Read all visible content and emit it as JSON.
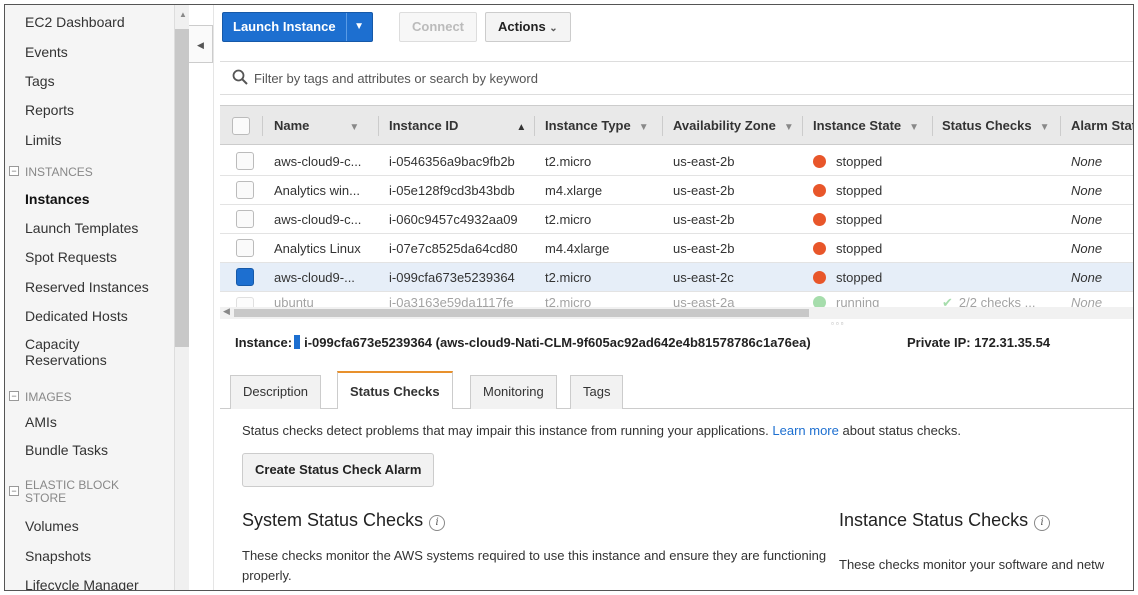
{
  "sidebar": {
    "items": [
      {
        "label": "EC2 Dashboard"
      },
      {
        "label": "Events"
      },
      {
        "label": "Tags"
      },
      {
        "label": "Reports"
      },
      {
        "label": "Limits"
      }
    ],
    "sections": [
      {
        "title": "INSTANCES",
        "items": [
          "Instances",
          "Launch Templates",
          "Spot Requests",
          "Reserved Instances",
          "Dedicated Hosts",
          "Capacity Reservations"
        ]
      },
      {
        "title": "IMAGES",
        "items": [
          "AMIs",
          "Bundle Tasks"
        ]
      },
      {
        "title": "ELASTIC BLOCK STORE",
        "items": [
          "Volumes",
          "Snapshots",
          "Lifecycle Manager"
        ]
      }
    ],
    "active": "Instances"
  },
  "toolbar": {
    "launch_label": "Launch Instance",
    "connect_label": "Connect",
    "actions_label": "Actions"
  },
  "search": {
    "placeholder": "Filter by tags and attributes or search by keyword"
  },
  "table": {
    "columns": [
      "Name",
      "Instance ID",
      "Instance Type",
      "Availability Zone",
      "Instance State",
      "Status Checks",
      "Alarm Stat"
    ],
    "rows": [
      {
        "name": "aws-cloud9-c...",
        "id": "i-0546356a9bac9fb2b",
        "type": "t2.micro",
        "az": "us-east-2b",
        "state": "stopped",
        "checks": "",
        "alarm": "None"
      },
      {
        "name": "Analytics win...",
        "id": "i-05e128f9cd3b43bdb",
        "type": "m4.xlarge",
        "az": "us-east-2b",
        "state": "stopped",
        "checks": "",
        "alarm": "None"
      },
      {
        "name": "aws-cloud9-c...",
        "id": "i-060c9457c4932aa09",
        "type": "t2.micro",
        "az": "us-east-2b",
        "state": "stopped",
        "checks": "",
        "alarm": "None"
      },
      {
        "name": "Analytics Linux",
        "id": "i-07e7c8525da64cd80",
        "type": "m4.4xlarge",
        "az": "us-east-2b",
        "state": "stopped",
        "checks": "",
        "alarm": "None"
      },
      {
        "name": "aws-cloud9-...",
        "id": "i-099cfa673e5239364",
        "type": "t2.micro",
        "az": "us-east-2c",
        "state": "stopped",
        "checks": "",
        "alarm": "None"
      },
      {
        "name": "ubuntu",
        "id": "i-0a3163e59da1117fe",
        "type": "t2.micro",
        "az": "us-east-2a",
        "state": "running",
        "checks": "2/2 checks ...",
        "alarm": "None"
      }
    ],
    "selected_index": 4
  },
  "colors": {
    "stopped": "#e8562a",
    "running": "#3bb44a",
    "accent": "#1d6fd0",
    "tab_accent": "#e8912d"
  },
  "details": {
    "instance_label": "Instance:",
    "instance_value": "i-099cfa673e5239364 (aws-cloud9-Nati-CLM-9f605ac92ad642e4b81578786c1a76ea)",
    "private_ip": "Private IP: 172.31.35.54",
    "tabs": [
      "Description",
      "Status Checks",
      "Monitoring",
      "Tags"
    ],
    "active_tab": "Status Checks",
    "intro_text": "Status checks detect problems that may impair this instance from running your applications.",
    "learn_more": "Learn more",
    "intro_suffix": "about status checks.",
    "alarm_button": "Create Status Check Alarm",
    "system_title": "System Status Checks",
    "system_text": "These checks monitor the AWS systems required to use this instance and ensure they are functioning properly.",
    "instance_title": "Instance Status Checks",
    "instance_text": "These checks monitor your software and netw",
    "info_glyph": "i"
  }
}
